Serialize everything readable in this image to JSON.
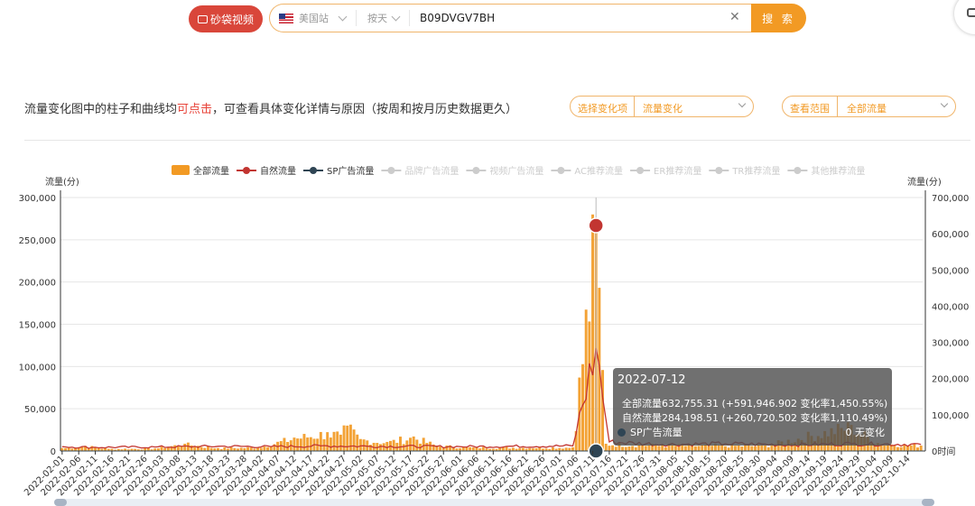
{
  "toolbar": {
    "brand_label": "砂袋视频",
    "marketplace": "美国站",
    "period": "按天",
    "asin": "B09DVGV7BH",
    "search_label": "搜 索"
  },
  "description": {
    "text_before": "流量变化图中的柱子和曲线均",
    "link": "可点击",
    "text_after": "，可查看具体变化详情与原因（按周和按月历史数据更久）"
  },
  "filters": {
    "change_label": "选择变化项",
    "change_value": "流量变化",
    "range_label": "查看范围",
    "range_value": "全部流量"
  },
  "colors": {
    "total": "#f29a24",
    "natural": "#c23531",
    "sp": "#2f4554",
    "inactive": "#cccccc",
    "accent": "#f29a24",
    "brand": "#d9463a"
  },
  "chart_data": {
    "type": "bar",
    "legend": [
      {
        "name": "全部流量",
        "active": true,
        "marker": "bar"
      },
      {
        "name": "自然流量",
        "active": true,
        "marker": "line"
      },
      {
        "name": "SP广告流量",
        "active": true,
        "marker": "line"
      },
      {
        "name": "品牌广告流量",
        "active": false
      },
      {
        "name": "视频广告流量",
        "active": false
      },
      {
        "name": "AC推荐流量",
        "active": false
      },
      {
        "name": "ER推荐流量",
        "active": false
      },
      {
        "name": "TR推荐流量",
        "active": false
      },
      {
        "name": "其他推荐流量",
        "active": false
      }
    ],
    "legend_position": "top",
    "y_left": {
      "label": "流量(分)",
      "min": 0,
      "max": 300000,
      "ticks": [
        "0",
        "50,000",
        "100,000",
        "150,000",
        "200,000",
        "250,000",
        "300,000"
      ]
    },
    "y_right": {
      "label": "流量(分)",
      "min": 0,
      "max": 700000,
      "ticks": [
        "0",
        "100,000",
        "200,000",
        "300,000",
        "400,000",
        "500,000",
        "600,000",
        "700,000"
      ],
      "zero_suffix": "时间"
    },
    "x_start": "2022-02-01",
    "x_end": "2022-10-18",
    "x_tick_labels": [
      "2022-02-01",
      "2022-02-06",
      "2022-02-11",
      "2022-02-16",
      "2022-02-21",
      "2022-02-26",
      "2022-03-03",
      "2022-03-08",
      "2022-03-13",
      "2022-03-18",
      "2022-03-23",
      "2022-03-28",
      "2022-04-02",
      "2022-04-07",
      "2022-04-12",
      "2022-04-17",
      "2022-04-22",
      "2022-04-27",
      "2022-05-02",
      "2022-05-07",
      "2022-05-12",
      "2022-05-17",
      "2022-05-22",
      "2022-05-27",
      "2022-06-01",
      "2022-06-06",
      "2022-06-11",
      "2022-06-16",
      "2022-06-21",
      "2022-06-26",
      "2022-07-01",
      "2022-07-06",
      "2022-07-11",
      "2022-07-16",
      "2022-07-21",
      "2022-07-26",
      "2022-07-31",
      "2022-08-05",
      "2022-08-10",
      "2022-08-15",
      "2022-08-20",
      "2022-08-25",
      "2022-08-30",
      "2022-09-04",
      "2022-09-09",
      "2022-09-14",
      "2022-09-19",
      "2022-09-24",
      "2022-09-29",
      "2022-10-04",
      "2022-10-09",
      "2022-10-14"
    ],
    "total_bars_keypoints": [
      [
        "2022-02-01",
        8000
      ],
      [
        "2022-02-08",
        14000
      ],
      [
        "2022-02-15",
        6000
      ],
      [
        "2022-03-01",
        7000
      ],
      [
        "2022-03-10",
        20000
      ],
      [
        "2022-03-20",
        8000
      ],
      [
        "2022-04-01",
        10000
      ],
      [
        "2022-04-12",
        37000
      ],
      [
        "2022-04-22",
        52000
      ],
      [
        "2022-04-26",
        45000
      ],
      [
        "2022-04-28",
        70000
      ],
      [
        "2022-05-02",
        33000
      ],
      [
        "2022-05-10",
        25000
      ],
      [
        "2022-05-18",
        40000
      ],
      [
        "2022-05-25",
        15000
      ],
      [
        "2022-06-05",
        10000
      ],
      [
        "2022-07-05",
        10000
      ],
      [
        "2022-07-12",
        632755
      ],
      [
        "2022-07-15",
        20000
      ],
      [
        "2022-08-01",
        16000
      ],
      [
        "2022-09-01",
        15000
      ],
      [
        "2022-09-27",
        72000
      ],
      [
        "2022-10-05",
        22000
      ],
      [
        "2022-10-18",
        15000
      ]
    ],
    "natural_line_keypoints": [
      [
        "2022-02-01",
        12000
      ],
      [
        "2022-02-10",
        10000
      ],
      [
        "2022-03-01",
        11000
      ],
      [
        "2022-03-20",
        13000
      ],
      [
        "2022-04-05",
        12000
      ],
      [
        "2022-04-20",
        14000
      ],
      [
        "2022-05-05",
        13000
      ],
      [
        "2022-06-01",
        12000
      ],
      [
        "2022-07-05",
        14000
      ],
      [
        "2022-07-12",
        284198.51
      ],
      [
        "2022-07-16",
        25000
      ],
      [
        "2022-08-01",
        18000
      ],
      [
        "2022-08-20",
        20000
      ],
      [
        "2022-09-10",
        17000
      ],
      [
        "2022-09-27",
        20000
      ],
      [
        "2022-10-18",
        18000
      ]
    ],
    "sp_line_keypoints": [
      [
        "2022-02-01",
        0
      ],
      [
        "2022-10-18",
        0
      ]
    ],
    "tooltip": {
      "date": "2022-07-12",
      "rows": [
        {
          "name": "全部流量",
          "value": "632,755.31 (+591,946.902 变化率1,450.55%)",
          "color": "#f29a24"
        },
        {
          "name": "自然流量",
          "value": "284,198.51 (+260,720.502 变化率1,110.49%)",
          "color": "#c23531"
        },
        {
          "name": "SP广告流量",
          "value": "0 无变化",
          "color": "#2f4554"
        }
      ]
    },
    "highlight_date": "2022-07-12"
  }
}
